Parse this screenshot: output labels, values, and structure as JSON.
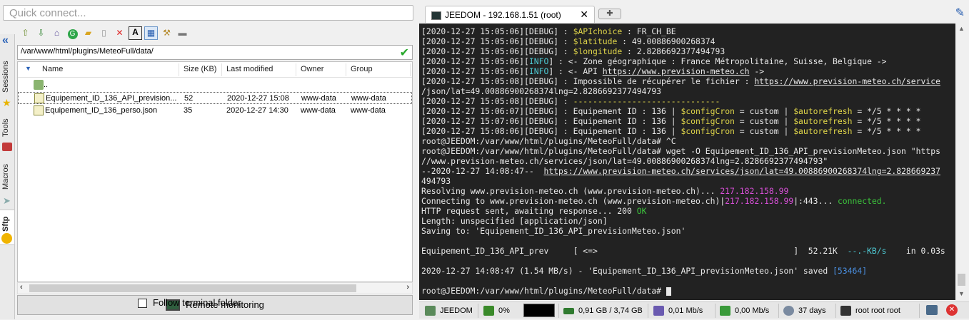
{
  "quick_connect": {
    "placeholder": "Quick connect..."
  },
  "side_tabs": {
    "sessions": "Sessions",
    "tools": "Tools",
    "macros": "Macros",
    "sftp": "Sftp"
  },
  "sftp": {
    "path": "/var/www/html/plugins/MeteoFull/data/",
    "columns": {
      "name": "Name",
      "size": "Size (KB)",
      "modified": "Last modified",
      "owner": "Owner",
      "group": "Group"
    },
    "parent_dir": "..",
    "files": [
      {
        "name": "Equipement_ID_136_API_prevision...",
        "size": "52",
        "modified": "2020-12-27 15:08",
        "owner": "www-data",
        "group": "www-data"
      },
      {
        "name": "Equipement_ID_136_perso.json",
        "size": "35",
        "modified": "2020-12-27 14:30",
        "owner": "www-data",
        "group": "www-data"
      }
    ],
    "remote_monitoring": "Remote monitoring",
    "follow_terminal": "Follow terminal folder"
  },
  "terminal_tab": {
    "title": "JEEDOM - 192.168.1.51 (root)"
  },
  "terminal": {
    "lines": [
      [
        "[2020-12-27 15:05:06][DEBUG] : ",
        "$APIchoice",
        " : FR_CH_BE"
      ],
      [
        "[2020-12-27 15:05:06][DEBUG] : ",
        "$latitude",
        " : 49.00886900268374"
      ],
      [
        "[2020-12-27 15:05:06][DEBUG] : ",
        "$longitude",
        " : 2.8286692377494793"
      ],
      [
        "[2020-12-27 15:05:06][",
        "INFO",
        "] : <- Zone géographique : France Métropolitaine, Suisse, Belgique ->"
      ],
      [
        "[2020-12-27 15:05:06][",
        "INFO",
        "] : <- API ",
        "https://www.prevision-meteo.ch",
        " ->"
      ],
      [
        "[2020-12-27 15:05:08][DEBUG] : Impossible de récupérer le fichier : ",
        "https://www.prevision-meteo.ch/service"
      ],
      [
        "/json/lat=49.00886900268374lng=2.8286692377494793"
      ],
      [
        "[2020-12-27 15:05:08][DEBUG] : ",
        "------------------------------"
      ],
      [
        "[2020-12-27 15:06:07][DEBUG] : Equipement ID : 136 | ",
        "$configCron",
        " = custom | ",
        "$autorefresh",
        " = */5 * * * *"
      ],
      [
        "[2020-12-27 15:07:06][DEBUG] : Equipement ID : 136 | ",
        "$configCron",
        " = custom | ",
        "$autorefresh",
        " = */5 * * * *"
      ],
      [
        "[2020-12-27 15:08:06][DEBUG] : Equipement ID : 136 | ",
        "$configCron",
        " = custom | ",
        "$autorefresh",
        " = */5 * * * *"
      ],
      [
        "root@JEEDOM:/var/www/html/plugins/MeteoFull/data# ^C"
      ],
      [
        "root@JEEDOM:/var/www/html/plugins/MeteoFull/data# wget -O Equipement_ID_136_API_previsionMeteo.json \"https"
      ],
      [
        "//www.prevision-meteo.ch/services/json/lat=49.00886900268374lng=2.8286692377494793\""
      ],
      [
        "--2020-12-27 14:08:47--  ",
        "https://www.prevision-meteo.ch/services/json/lat=49.00886900268374lng=2.828669237"
      ],
      [
        "494793"
      ],
      [
        "Resolving www.prevision-meteo.ch (www.prevision-meteo.ch)... ",
        "217.182.158.99"
      ],
      [
        "Connecting to www.prevision-meteo.ch (www.prevision-meteo.ch)|",
        "217.182.158.99",
        "|:443... ",
        "connected."
      ],
      [
        "HTTP request sent, awaiting response... 200 ",
        "OK"
      ],
      [
        "Length: unspecified [application/json]"
      ],
      [
        "Saving to: 'Equipement_ID_136_API_previsionMeteo.json'"
      ],
      [
        ""
      ],
      [
        "Equipement_ID_136_API_prev     [ <=>                                        ]  52.21K  ",
        "--.-KB/s",
        "    in 0.03s"
      ],
      [
        ""
      ],
      [
        "2020-12-27 14:08:47 (1.54 MB/s) - 'Equipement_ID_136_API_previsionMeteo.json' saved ",
        "[53464]"
      ],
      [
        ""
      ],
      [
        "root@JEEDOM:/var/www/html/plugins/MeteoFull/data# "
      ]
    ]
  },
  "status_bar": {
    "host": "JEEDOM",
    "cpu": "0%",
    "memory": "0,91 GB / 3,74 GB",
    "upload": "0,01 Mb/s",
    "download": "0,00 Mb/s",
    "uptime": "37 days",
    "users": "root  root  root"
  }
}
